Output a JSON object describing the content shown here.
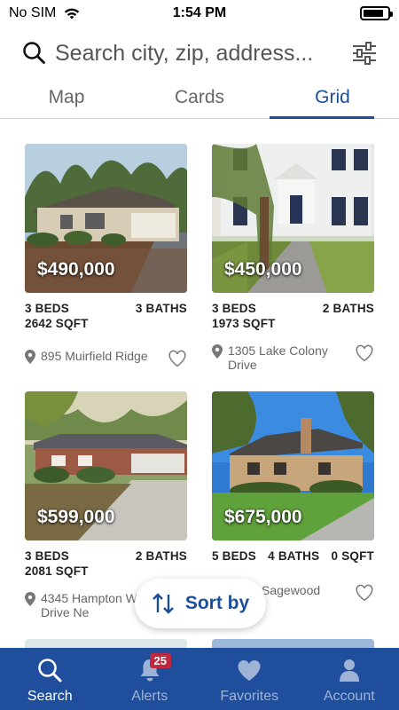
{
  "status_bar": {
    "carrier": "No SIM",
    "time": "1:54 PM",
    "battery_level": 0.85
  },
  "search": {
    "placeholder": "Search city, zip, address..."
  },
  "tabs": [
    {
      "label": "Map",
      "active": false
    },
    {
      "label": "Cards",
      "active": false
    },
    {
      "label": "Grid",
      "active": true
    }
  ],
  "listings": [
    {
      "price": "$490,000",
      "beds": "3 BEDS",
      "baths": "3 BATHS",
      "sqft": "2642 SQFT",
      "address": "895 Muirfield Ridge",
      "favorite": false
    },
    {
      "price": "$450,000",
      "beds": "3 BEDS",
      "baths": "2 BATHS",
      "sqft": "1973 SQFT",
      "address": "1305 Lake Colony Drive",
      "favorite": false
    },
    {
      "price": "$599,000",
      "beds": "3 BEDS",
      "baths": "2 BATHS",
      "sqft": "2081 SQFT",
      "address": "4345 Hampton Woods Drive Ne",
      "favorite": false
    },
    {
      "price": "$675,000",
      "beds": "5 BEDS",
      "baths": "4 BATHS",
      "sqft": "0 SQFT",
      "address": "Sagewood",
      "favorite": false
    }
  ],
  "sort_button": {
    "label": "Sort by"
  },
  "bottom_nav": [
    {
      "label": "Search",
      "icon": "search-icon",
      "active": true
    },
    {
      "label": "Alerts",
      "icon": "bell-icon",
      "active": false,
      "badge": "25"
    },
    {
      "label": "Favorites",
      "icon": "heart-icon",
      "active": false
    },
    {
      "label": "Account",
      "icon": "person-icon",
      "active": false
    }
  ],
  "colors": {
    "accent": "#1b4f9c",
    "nav_background": "#1f4e9d",
    "badge": "#c0283f"
  }
}
